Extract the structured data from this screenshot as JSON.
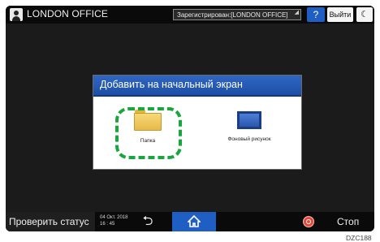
{
  "topbar": {
    "office_title": "LONDON OFFICE",
    "login_status": "Зарегистрирован:[LONDON OFFICE]",
    "help_label": "?",
    "logout_label": "Выйти",
    "energy_icon": "moon-icon"
  },
  "dialog": {
    "title": "Добавить на начальный экран",
    "options": [
      {
        "label": "Папка",
        "icon": "folder-icon",
        "highlighted": true
      },
      {
        "label": "Фоновый рисунок",
        "icon": "wallpaper-icon",
        "highlighted": false
      }
    ]
  },
  "bottombar": {
    "check_status_label": "Проверить статус",
    "date": "04 Окт. 2018",
    "time": "16 : 45",
    "back_icon": "back-arrow-icon",
    "home_icon": "home-icon",
    "stop_label": "Стоп"
  },
  "figure_code": "DZC188",
  "colors": {
    "accent_blue": "#1f5fc4",
    "highlight_green": "#1aa63c",
    "stop_red": "#e34a3c"
  }
}
